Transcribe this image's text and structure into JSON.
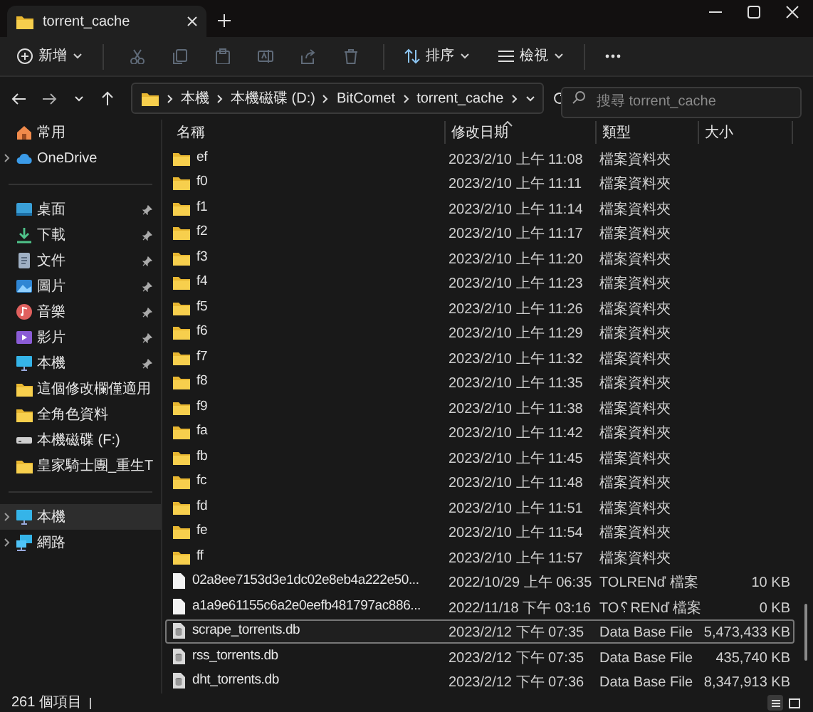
{
  "window": {
    "tab": {
      "title": "torrent_cache",
      "selected": true
    }
  },
  "toolbar": {
    "new_label": "新增",
    "sort_label": "排序",
    "view_label": "檢視",
    "actions": [
      {
        "kind": "cut",
        "disabled": true
      },
      {
        "kind": "copy",
        "disabled": true
      },
      {
        "kind": "paste",
        "disabled": true
      },
      {
        "kind": "rename",
        "disabled": true
      },
      {
        "kind": "share",
        "disabled": true
      },
      {
        "kind": "delete",
        "disabled": true
      }
    ]
  },
  "address": {
    "crumbs": [
      "本機",
      "本機磁碟 (D:)",
      "BitComet",
      "torrent_cache"
    ]
  },
  "search": {
    "placeholder": "搜尋 torrent_cache"
  },
  "sidebar": {
    "groups": [
      [
        {
          "label": "常用",
          "kind": "home",
          "expandable": false,
          "pinned": false,
          "selected": false
        },
        {
          "label": "OneDrive",
          "kind": "cloud",
          "expandable": true,
          "pinned": false,
          "selected": false
        }
      ],
      [
        {
          "label": "桌面",
          "kind": "desktop",
          "expandable": false,
          "pinned": true,
          "selected": false
        },
        {
          "label": "下載",
          "kind": "download",
          "expandable": false,
          "pinned": true,
          "selected": false
        },
        {
          "label": "文件",
          "kind": "document",
          "expandable": false,
          "pinned": true,
          "selected": false
        },
        {
          "label": "圖片",
          "kind": "picture",
          "expandable": false,
          "pinned": true,
          "selected": false
        },
        {
          "label": "音樂",
          "kind": "music",
          "expandable": false,
          "pinned": true,
          "selected": false
        },
        {
          "label": "影片",
          "kind": "video",
          "expandable": false,
          "pinned": true,
          "selected": false
        },
        {
          "label": "本機",
          "kind": "pc",
          "expandable": false,
          "pinned": true,
          "selected": false
        },
        {
          "label": "這個修改欄僅適用",
          "kind": "folder",
          "expandable": false,
          "pinned": false,
          "selected": false
        },
        {
          "label": "全角色資料",
          "kind": "folder",
          "expandable": false,
          "pinned": false,
          "selected": false
        },
        {
          "label": "本機磁碟 (F:)",
          "kind": "drive",
          "expandable": false,
          "pinned": false,
          "selected": false
        },
        {
          "label": "皇家騎士團_重生T",
          "kind": "folder",
          "expandable": false,
          "pinned": false,
          "selected": false
        }
      ],
      [
        {
          "label": "本機",
          "kind": "pc",
          "expandable": true,
          "pinned": false,
          "selected": true
        },
        {
          "label": "網路",
          "kind": "network",
          "expandable": true,
          "pinned": false,
          "selected": false
        }
      ]
    ]
  },
  "table": {
    "columns": [
      {
        "label": "名稱",
        "sorted": false
      },
      {
        "label": "修改日期",
        "sorted": true
      },
      {
        "label": "類型",
        "sorted": false
      },
      {
        "label": "大小",
        "sorted": false
      }
    ],
    "rows": [
      {
        "kind": "folder",
        "name": "ef",
        "date": "2023/2/10 上午 11:08",
        "type": "檔案資料夾",
        "selected": false
      },
      {
        "kind": "folder",
        "name": "f0",
        "date": "2023/2/10 上午 11:11",
        "type": "檔案資料夾",
        "selected": false
      },
      {
        "kind": "folder",
        "name": "f1",
        "date": "2023/2/10 上午 11:14",
        "type": "檔案資料夾",
        "selected": false
      },
      {
        "kind": "folder",
        "name": "f2",
        "date": "2023/2/10 上午 11:17",
        "type": "檔案資料夾",
        "selected": false
      },
      {
        "kind": "folder",
        "name": "f3",
        "date": "2023/2/10 上午 11:20",
        "type": "檔案資料夾",
        "selected": false
      },
      {
        "kind": "folder",
        "name": "f4",
        "date": "2023/2/10 上午 11:23",
        "type": "檔案資料夾",
        "selected": false
      },
      {
        "kind": "folder",
        "name": "f5",
        "date": "2023/2/10 上午 11:26",
        "type": "檔案資料夾",
        "selected": false
      },
      {
        "kind": "folder",
        "name": "f6",
        "date": "2023/2/10 上午 11:29",
        "type": "檔案資料夾",
        "selected": false
      },
      {
        "kind": "folder",
        "name": "f7",
        "date": "2023/2/10 上午 11:32",
        "type": "檔案資料夾",
        "selected": false
      },
      {
        "kind": "folder",
        "name": "f8",
        "date": "2023/2/10 上午 11:35",
        "type": "檔案資料夾",
        "selected": false
      },
      {
        "kind": "folder",
        "name": "f9",
        "date": "2023/2/10 上午 11:38",
        "type": "檔案資料夾",
        "selected": false
      },
      {
        "kind": "folder",
        "name": "fa",
        "date": "2023/2/10 上午 11:42",
        "type": "檔案資料夾",
        "selected": false
      },
      {
        "kind": "folder",
        "name": "fb",
        "date": "2023/2/10 上午 11:45",
        "type": "檔案資料夾",
        "selected": false
      },
      {
        "kind": "folder",
        "name": "fc",
        "date": "2023/2/10 上午 11:48",
        "type": "檔案資料夾",
        "selected": false
      },
      {
        "kind": "folder",
        "name": "fd",
        "date": "2023/2/10 上午 11:51",
        "type": "檔案資料夾",
        "selected": false
      },
      {
        "kind": "folder",
        "name": "fe",
        "date": "2023/2/10 上午 11:54",
        "type": "檔案資料夾",
        "selected": false
      },
      {
        "kind": "folder",
        "name": "ff",
        "date": "2023/2/10 上午 11:57",
        "type": "檔案資料夾",
        "selected": false
      },
      {
        "kind": "file",
        "name": "02a8ee7153d3e1dc02e8eb4a222e50...",
        "date": "2022/10/29 上午 06:35",
        "type": "TOLRENď 檔案",
        "size": "10 KB",
        "selected": false
      },
      {
        "kind": "file",
        "name": "a1a9e61155c6a2e0eefb481797ac886...",
        "date": "2022/11/18 下午 03:16",
        "type": "TO␦RENď 檔案",
        "size": "0 KB",
        "selected": false
      },
      {
        "kind": "db",
        "name": "scrape_torrents.db",
        "date": "2023/2/12 下午 07:35",
        "type": "Data Base File",
        "size": "5,473,433 KB",
        "selected": true
      },
      {
        "kind": "db",
        "name": "rss_torrents.db",
        "date": "2023/2/12 下午 07:35",
        "type": "Data Base File",
        "size": "435,740 KB",
        "selected": false
      },
      {
        "kind": "db",
        "name": "dht_torrents.db",
        "date": "2023/2/12 下午 07:36",
        "type": "Data Base File",
        "size": "8,347,913 KB",
        "selected": false
      }
    ]
  },
  "status_bar": {
    "count": "261 個項目",
    "views": [
      {
        "kind": "details",
        "selected": true
      },
      {
        "kind": "tiles",
        "selected": false
      }
    ]
  }
}
